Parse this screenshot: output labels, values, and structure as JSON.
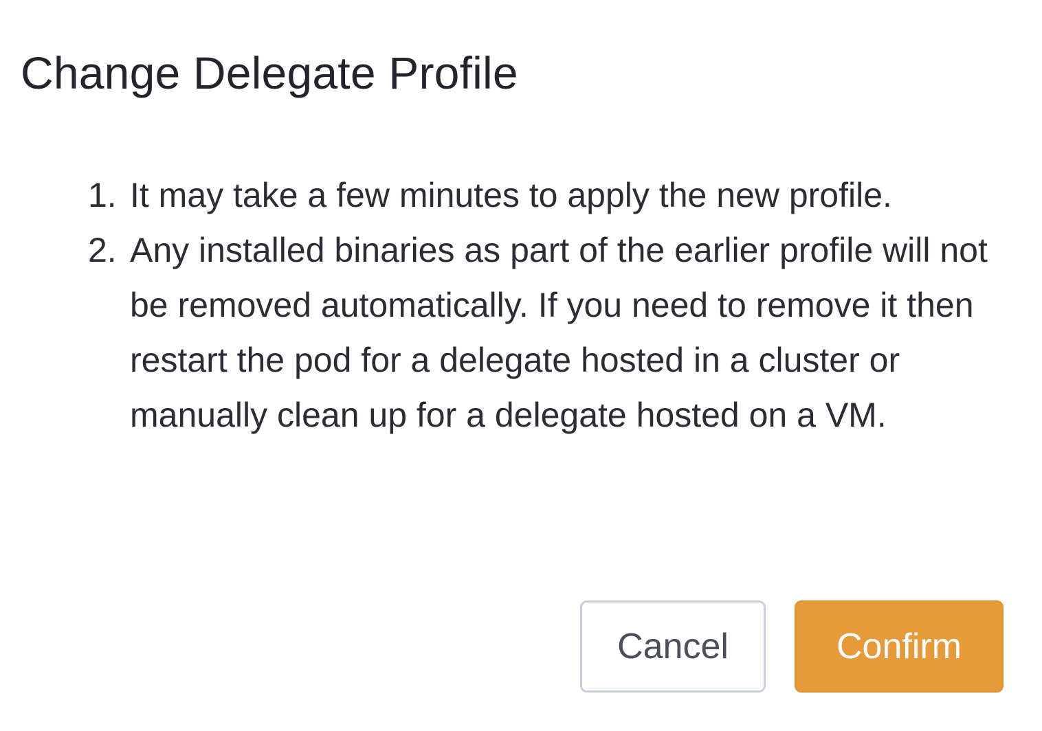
{
  "dialog": {
    "title": "Change Delegate Profile",
    "notes": [
      {
        "number": "1.",
        "text": "It may take a few minutes to apply the new profile."
      },
      {
        "number": "2.",
        "text": "Any installed binaries as part of the earlier profile will not be removed automatically. If you need to remove it then restart the pod for a delegate hosted in a cluster or manually clean up for a delegate hosted on a VM."
      }
    ],
    "cancel_label": "Cancel",
    "confirm_label": "Confirm"
  },
  "colors": {
    "confirm_button": "#e69a38",
    "cancel_border": "#c9cfdb",
    "text": "#22252b"
  }
}
